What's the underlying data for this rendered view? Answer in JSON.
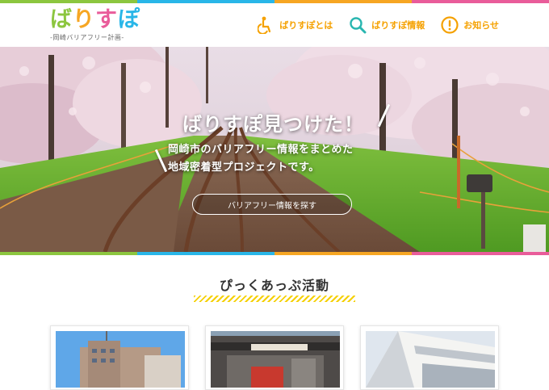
{
  "brand": {
    "logo_part1": "ば",
    "logo_part2": "り",
    "logo_part3": "す",
    "logo_part4": "ぽ",
    "subtitle": "-岡崎バリアフリー計画-",
    "colors": [
      "#8cc63f",
      "#f6a623",
      "#e95c9a",
      "#29b6e8"
    ]
  },
  "nav": {
    "items": [
      {
        "label": "ばりすぽとは",
        "icon": "wheelchair-icon"
      },
      {
        "label": "ばりすぽ情報",
        "icon": "search-icon"
      },
      {
        "label": "お知らせ",
        "icon": "exclamation-icon"
      }
    ],
    "accent": "#f5a100"
  },
  "hero": {
    "title": "ばりすぽ見つけた！",
    "line1": "岡崎市のバリアフリー情報をまとめた",
    "line2": "地域密着型プロジェクトです。",
    "button": "バリアフリー情報を探す"
  },
  "activities": {
    "title": "ぴっくあっぷ活動",
    "cards": [
      {
        "image": "city-building-photo"
      },
      {
        "image": "station-photo"
      },
      {
        "image": "modern-building-photo"
      }
    ]
  }
}
